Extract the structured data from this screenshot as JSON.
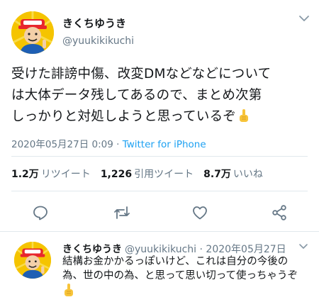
{
  "tweet": {
    "author_name": "きくちゆうき",
    "author_handle": "@yuukikikuchi",
    "text_line1": "受けた誹謗中傷、改変DMなどなどについて",
    "text_line2": "は大体データ残してあるので、まとめ次第",
    "text_line3": "しっかりと対処しようと思っているぞ",
    "emoji": "index-pointing-up-icon",
    "timestamp": "2020年05月27日 0:09",
    "separator": " · ",
    "source": "Twitter for iPhone"
  },
  "stats": {
    "retweets_count": "1.2万",
    "retweets_label": "リツイート",
    "quotes_count": "1,226",
    "quotes_label": "引用ツイート",
    "likes_count": "8.7万",
    "likes_label": "いいね"
  },
  "actions": [
    "reply-icon",
    "retweet-icon",
    "like-icon",
    "share-icon"
  ],
  "reply": {
    "author_name": "きくちゆうき",
    "author_handle": "@yuukikikuchi",
    "separator": " · ",
    "date": "2020年05月27日",
    "text_line1": "結構お金かかるっぽいけど、これは自分の今後の",
    "text_line2": "為、世の中の為、と思って思い切って使っちゃうぞ",
    "emoji": "index-pointing-up-icon"
  },
  "colors": {
    "accent": "#1da1f2",
    "text": "#14171a",
    "muted": "#657786",
    "divider": "#e1e8ed",
    "avatar_bg": "#f5c400"
  }
}
